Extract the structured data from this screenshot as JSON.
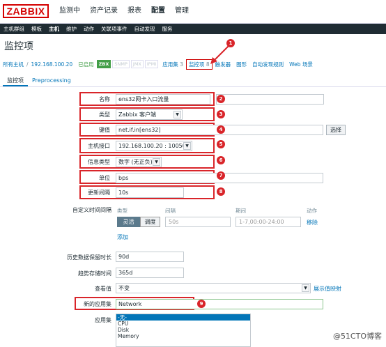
{
  "app": {
    "logo": "ZABBIX"
  },
  "main_menu": [
    "监测中",
    "资产记录",
    "报表",
    "配置",
    "管理"
  ],
  "main_menu_active": 3,
  "sub_menu": [
    "主机群组",
    "模板",
    "主机",
    "维护",
    "动作",
    "关联项事件",
    "自动发现",
    "服务"
  ],
  "sub_menu_active": 2,
  "page_title": "监控项",
  "breadcrumb": {
    "all_hosts": "所有主机",
    "sep": "/",
    "host": "192.168.100.20",
    "status": "已启用",
    "badges": [
      "ZBX",
      "SNMP",
      "JMX",
      "IPMI"
    ],
    "apps_label": "应用集",
    "apps_count": "3",
    "items_label": "监控项",
    "items_count": "8",
    "triggers": "触发器",
    "graphs": "图形",
    "discovery": "自动发现规则",
    "web": "Web 场景"
  },
  "tabs": [
    "监控项",
    "Preprocessing"
  ],
  "form": {
    "name_label": "名称",
    "name_value": "ens32网卡入口流量",
    "type_label": "类型",
    "type_value": "Zabbix 客户端",
    "key_label": "键值",
    "key_value": "net.if.in[ens32]",
    "key_button": "选择",
    "iface_label": "主机接口",
    "iface_value": "192.168.100.20 : 10050",
    "info_label": "信息类型",
    "info_value": "数字 (无正负)",
    "unit_label": "单位",
    "unit_value": "bps",
    "interval_label": "更新间隔",
    "interval_value": "10s",
    "custom_label": "自定义时间间隔",
    "custom_hdr_type": "类型",
    "custom_hdr_interval": "间隔",
    "custom_hdr_period": "期间",
    "custom_hdr_action": "动作",
    "flex": "灵活",
    "schedule": "调度",
    "interval_placeholder": "50s",
    "period_placeholder": "1-7,00:00-24:00",
    "remove": "移除",
    "add": "添加",
    "history_label": "历史数据保留时长",
    "history_value": "90d",
    "trend_label": "趋势存储时间",
    "trend_value": "365d",
    "show_label": "查看值",
    "show_value": "不变",
    "show_link": "展示值映射",
    "newapp_label": "新的应用集",
    "newapp_value": "Network",
    "apps_label": "应用集",
    "apps_list": [
      "-无-",
      "CPU",
      "Disk",
      "Memory"
    ]
  },
  "markers": [
    "1",
    "2",
    "3",
    "4",
    "5",
    "6",
    "7",
    "8",
    "9"
  ],
  "watermark": "@51CTO博客"
}
